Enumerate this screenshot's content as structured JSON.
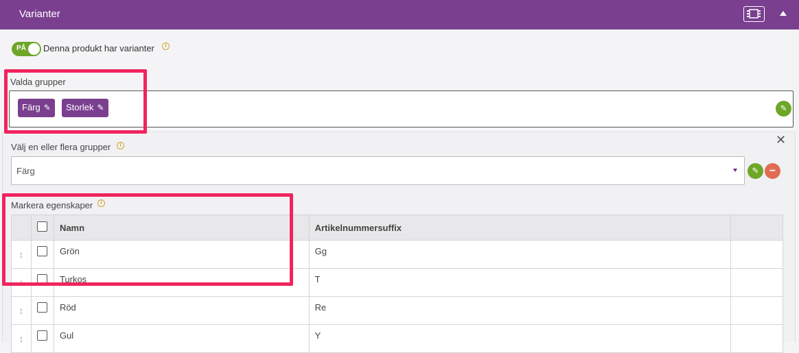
{
  "header": {
    "title": "Varianter"
  },
  "toggle": {
    "state": "PÅ",
    "label": "Denna produkt har varianter"
  },
  "selected_groups": {
    "label": "Valda grupper",
    "chips": [
      "Färg",
      "Storlek"
    ]
  },
  "group_picker": {
    "label": "Välj en eller flera grupper",
    "value": "Färg"
  },
  "properties": {
    "label": "Markera egenskaper",
    "columns": [
      "Namn",
      "Artikelnummersuffix"
    ],
    "rows": [
      {
        "name": "Grön",
        "suffix": "Gg"
      },
      {
        "name": "Turkos",
        "suffix": "T"
      },
      {
        "name": "Röd",
        "suffix": "Re"
      },
      {
        "name": "Gul",
        "suffix": "Y"
      }
    ]
  },
  "icons": {
    "film": "film-icon",
    "collapse": "caret-up-icon",
    "info": "info-icon",
    "pencil": "pencil-icon",
    "remove": "minus-circle-icon",
    "close": "close-icon",
    "drag": "drag-handle-icon"
  },
  "colors": {
    "header": "#7a3f8f",
    "accent_green": "#6ea628",
    "danger": "#e06c54",
    "highlight": "#f0245e"
  }
}
